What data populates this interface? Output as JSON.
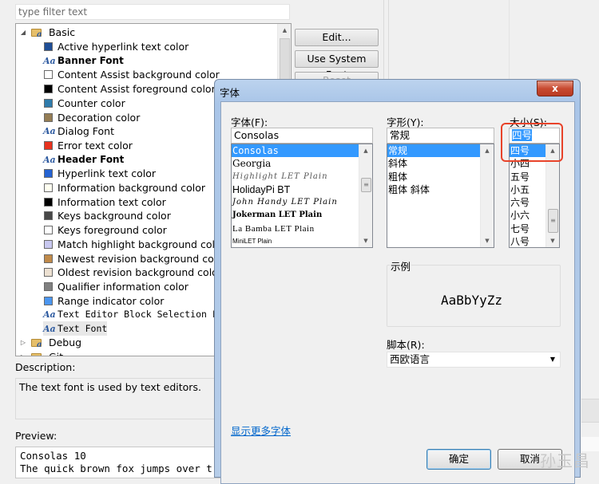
{
  "prefs": {
    "filter_placeholder": "type filter text",
    "tree": {
      "basic": {
        "label": "Basic",
        "expanded": true
      },
      "items": [
        {
          "type": "color",
          "label": "Active hyperlink text color",
          "color": "#1f4e96"
        },
        {
          "type": "font",
          "label": "Banner Font",
          "style": "bold"
        },
        {
          "type": "color",
          "label": "Content Assist background color",
          "color": "#ffffff"
        },
        {
          "type": "color",
          "label": "Content Assist foreground color",
          "color": "#000000"
        },
        {
          "type": "color",
          "label": "Counter color",
          "color": "#2f7bab"
        },
        {
          "type": "color",
          "label": "Decoration color",
          "color": "#957d55"
        },
        {
          "type": "font",
          "label": "Dialog Font",
          "style": "normal"
        },
        {
          "type": "color",
          "label": "Error text color",
          "color": "#e8321e"
        },
        {
          "type": "font",
          "label": "Header Font",
          "style": "bold"
        },
        {
          "type": "color",
          "label": "Hyperlink text color",
          "color": "#2563d2"
        },
        {
          "type": "color",
          "label": "Information background color",
          "color": "#fffff0"
        },
        {
          "type": "color",
          "label": "Information text color",
          "color": "#000000"
        },
        {
          "type": "color",
          "label": "Keys background color",
          "color": "#484848"
        },
        {
          "type": "color",
          "label": "Keys foreground color",
          "color": "#ffffff"
        },
        {
          "type": "color",
          "label": "Match highlight background color",
          "color": "#c8c8f0"
        },
        {
          "type": "color",
          "label": "Newest revision background color",
          "color": "#c08a4a"
        },
        {
          "type": "color",
          "label": "Oldest revision background color",
          "color": "#ede1d2"
        },
        {
          "type": "color",
          "label": "Qualifier information color",
          "color": "#808080"
        },
        {
          "type": "color",
          "label": "Range indicator color",
          "color": "#4b96f0"
        },
        {
          "type": "font",
          "label": "Text Editor Block Selection Font",
          "style": "mono"
        },
        {
          "type": "font",
          "label": "Text Font",
          "style": "mono",
          "selected": true
        }
      ],
      "debug": {
        "label": "Debug"
      },
      "git": {
        "label": "Git"
      }
    },
    "buttons": {
      "edit": "Edit...",
      "use_system_font": "Use System Font",
      "reset": "Reset"
    },
    "description_label": "Description:",
    "description_text": "The text font is used by text editors.",
    "preview_label": "Preview:",
    "preview_lines": [
      "Consolas 10",
      "The quick brown fox jumps over t"
    ]
  },
  "font_dialog": {
    "title": "字体",
    "close_label": "x",
    "font_label": "字体(F):",
    "font_value": "Consolas",
    "font_list": [
      "Consolas",
      "Georgia",
      "Highlight LET Plain",
      "HolidayPi BT",
      "John Handy LET Plain",
      "Jokerman LET Plain",
      "La Bamba LET Plain",
      "MiniLET Plain"
    ],
    "font_selected": 0,
    "style_label": "字形(Y):",
    "style_value": "常规",
    "style_list": [
      "常规",
      "斜体",
      "粗体",
      "粗体 斜体"
    ],
    "style_selected": 0,
    "size_label": "大小(S):",
    "size_value": "四号",
    "size_list": [
      "四号",
      "小四",
      "五号",
      "小五",
      "六号",
      "小六",
      "七号",
      "八号"
    ],
    "size_selected": 0,
    "sample_label": "示例",
    "sample_text": "AaBbYyZz",
    "script_label": "脚本(R):",
    "script_value": "西欧语言",
    "more_fonts_link": "显示更多字体",
    "ok_label": "确定",
    "cancel_label": "取消"
  },
  "watermark": "孙玉昌",
  "colors": {
    "selection": "#3399ff",
    "highlight_box": "#e8432a",
    "link": "#0066cc"
  }
}
